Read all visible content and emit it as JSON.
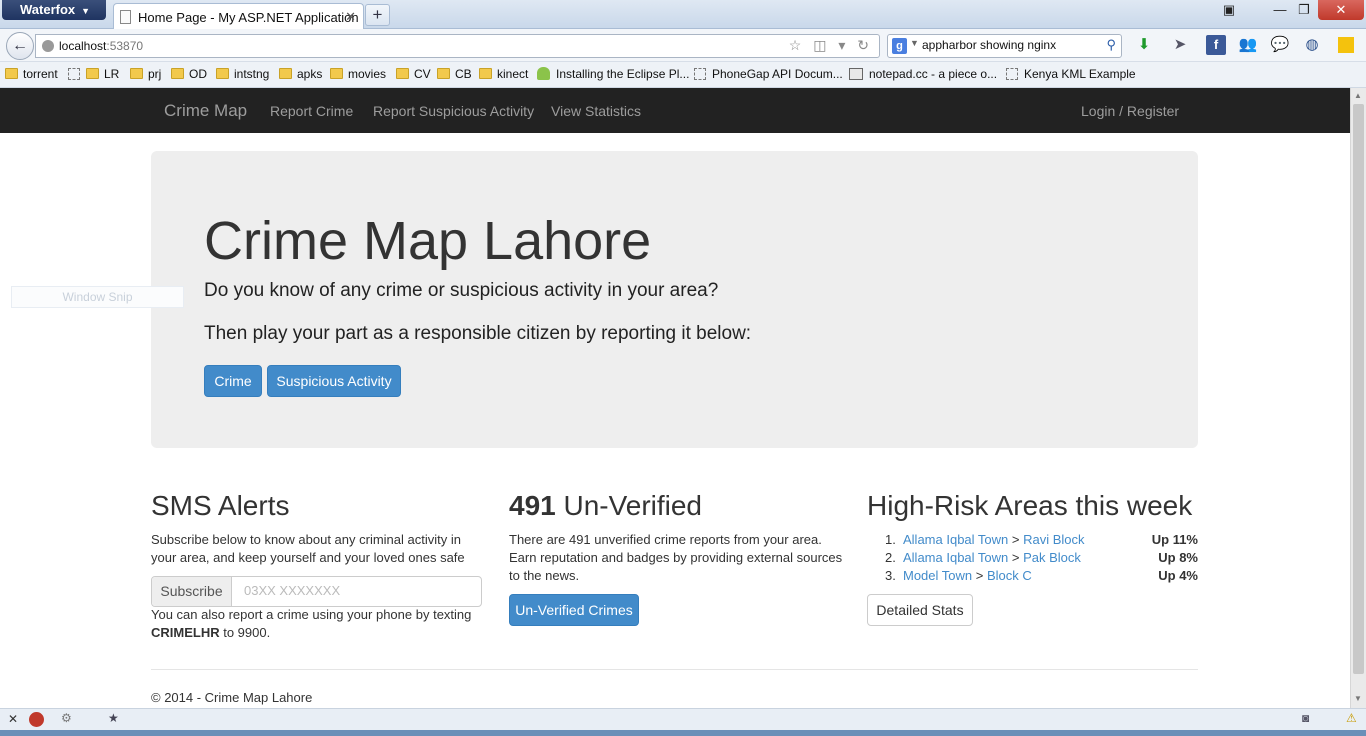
{
  "browser": {
    "app_name": "Waterfox",
    "tab_title": "Home Page - My ASP.NET Application",
    "url_host": "localhost",
    "url_port": ":53870",
    "search_engine": "g",
    "search_text": "appharbor showing nginx"
  },
  "bookmarks": [
    {
      "label": "torrent",
      "icon": "folder"
    },
    {
      "label": "LR",
      "icon": "folder"
    },
    {
      "label": "prj",
      "icon": "folder"
    },
    {
      "label": "OD",
      "icon": "folder"
    },
    {
      "label": "intstng",
      "icon": "folder"
    },
    {
      "label": "apks",
      "icon": "folder"
    },
    {
      "label": "movies",
      "icon": "folder"
    },
    {
      "label": "CV",
      "icon": "folder"
    },
    {
      "label": "CB",
      "icon": "folder"
    },
    {
      "label": "kinect",
      "icon": "folder"
    },
    {
      "label": "Installing the Eclipse Pl...",
      "icon": "android"
    },
    {
      "label": "PhoneGap API Docum...",
      "icon": "page"
    },
    {
      "label": "notepad.cc - a piece o...",
      "icon": "notepad"
    },
    {
      "label": "Kenya KML Example",
      "icon": "page"
    }
  ],
  "nav": {
    "brand": "Crime Map",
    "links": [
      "Report Crime",
      "Report Suspicious Activity",
      "View Statistics"
    ],
    "login": "Login / Register"
  },
  "hero": {
    "title": "Crime Map Lahore",
    "lead1": "Do you know of any crime or suspicious activity in your area?",
    "lead2": "Then play your part as a responsible citizen by reporting it below:",
    "btn_crime": "Crime",
    "btn_suspicious": "Suspicious Activity"
  },
  "sms": {
    "heading": "SMS Alerts",
    "text": "Subscribe below to know about any criminal activity in your area, and keep yourself and your loved ones safe",
    "subscribe_label": "Subscribe",
    "phone_placeholder": "03XX XXXXXXX",
    "note_prefix": "You can also report a crime using your phone by texting ",
    "keyword": "CRIMELHR",
    "note_suffix": " to 9900."
  },
  "unverified": {
    "count": "491",
    "heading_rest": " Un-Verified",
    "text": "There are 491 unverified crime reports from your area. Earn reputation and badges by providing external sources to the news.",
    "button": "Un-Verified Crimes"
  },
  "risk": {
    "heading": "High-Risk Areas this week",
    "items": [
      {
        "num": "1.",
        "town": "Allama Iqbal Town",
        "block": "Ravi Block",
        "trend": "Up 11%"
      },
      {
        "num": "2.",
        "town": "Allama Iqbal Town",
        "block": "Pak Block",
        "trend": "Up 8%"
      },
      {
        "num": "3.",
        "town": "Model Town",
        "block": "Block C",
        "trend": "Up 4%"
      }
    ],
    "separator": " > ",
    "button": "Detailed Stats"
  },
  "footer": "© 2014 - Crime Map Lahore",
  "overlay": {
    "snip": "Window Snip"
  },
  "colors": {
    "primary": "#428bca",
    "navbar": "#222222",
    "jumbotron": "#eeeeee"
  }
}
